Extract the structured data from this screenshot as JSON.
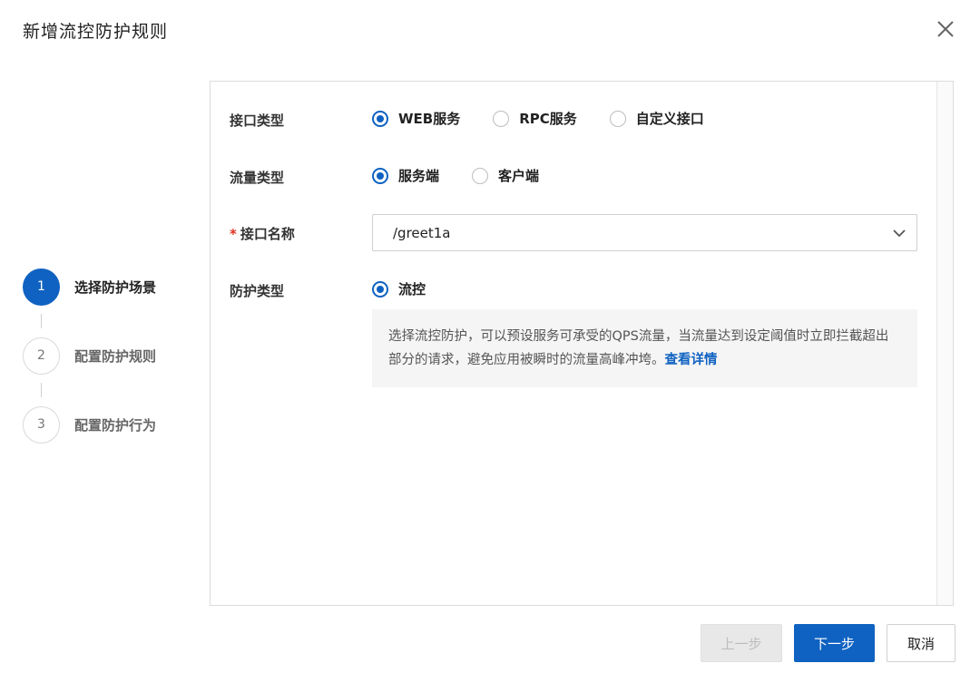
{
  "dialog": {
    "title": "新增流控防护规则"
  },
  "steps": [
    {
      "number": "1",
      "label": "选择防护场景",
      "state": "active"
    },
    {
      "number": "2",
      "label": "配置防护规则",
      "state": "inactive"
    },
    {
      "number": "3",
      "label": "配置防护行为",
      "state": "inactive"
    }
  ],
  "form": {
    "interface_type": {
      "label": "接口类型",
      "options": [
        "WEB服务",
        "RPC服务",
        "自定义接口"
      ],
      "selected": "WEB服务"
    },
    "traffic_type": {
      "label": "流量类型",
      "options": [
        "服务端",
        "客户端"
      ],
      "selected": "服务端"
    },
    "interface_name": {
      "required_mark": "*",
      "label": "接口名称",
      "value": "/greet1a"
    },
    "protection_type": {
      "label": "防护类型",
      "options": [
        "流控"
      ],
      "selected": "流控"
    },
    "description": {
      "text": "选择流控防护，可以预设服务可承受的QPS流量，当流量达到设定阈值时立即拦截超出部分的请求，避免应用被瞬时的流量高峰冲垮。",
      "link": "查看详情"
    }
  },
  "footer": {
    "prev_label": "上一步",
    "next_label": "下一步",
    "cancel_label": "取消"
  },
  "colors": {
    "accent": "#0f62c1",
    "required": "#e0301e"
  }
}
